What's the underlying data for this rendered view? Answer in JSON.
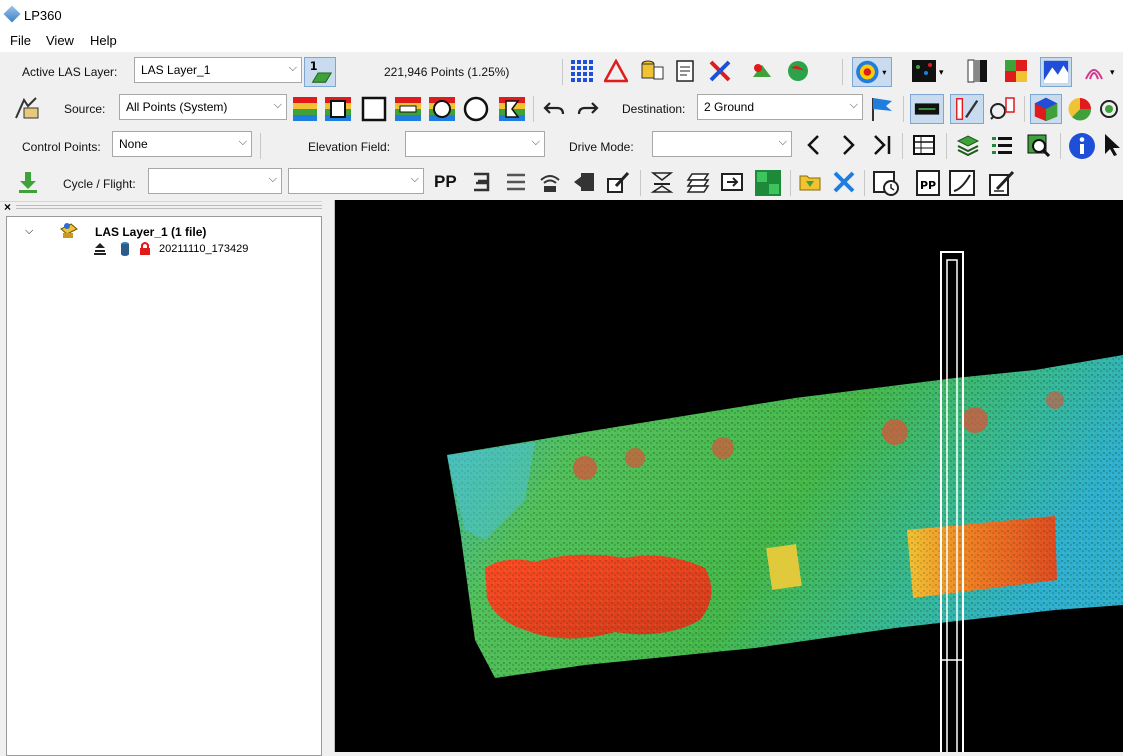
{
  "app": {
    "title": "LP360",
    "icon": "lp360-logo-icon"
  },
  "menu": [
    "File",
    "View",
    "Help"
  ],
  "toolbar1": {
    "active_layer_label": "Active LAS Layer:",
    "active_layer_value": "LAS Layer_1",
    "points_info": "221,946 Points (1.25%)"
  },
  "toolbar2": {
    "source_label": "Source:",
    "source_value": "All Points (System)",
    "destination_label": "Destination:",
    "destination_value": "2   Ground"
  },
  "toolbar3": {
    "control_points_label": "Control Points:",
    "control_points_value": "None",
    "elevation_field_label": "Elevation Field:",
    "elevation_field_value": "",
    "drive_mode_label": "Drive Mode:",
    "drive_mode_value": ""
  },
  "toolbar4": {
    "cycle_flight_label": "Cycle / Flight:",
    "cycle_flight_value": "",
    "secondary_value": "",
    "pp_label": "PP"
  },
  "tree": {
    "close_glyph": "×",
    "layer_label": "LAS Layer_1 (1 file)",
    "file_label": "20211110_173429"
  },
  "colors": {
    "accent_blue": "#1f4fd8",
    "pointcloud_low": "#22a6e0",
    "pointcloud_mid": "#2fbf3a",
    "pointcloud_high": "#e83a1c",
    "profile_outline": "#ffffff"
  }
}
